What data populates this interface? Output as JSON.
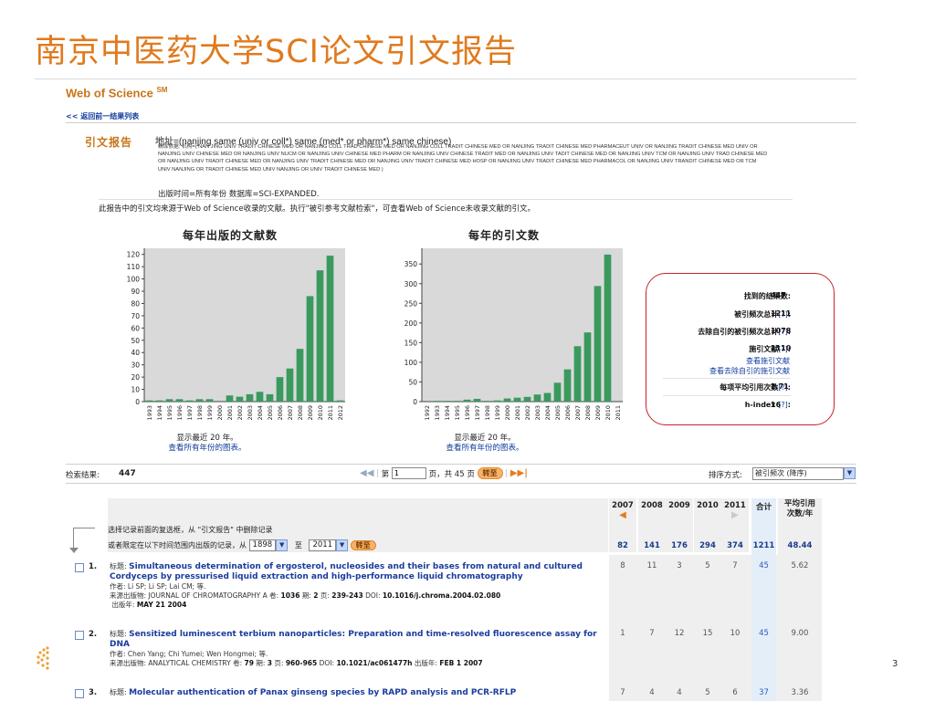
{
  "slide": {
    "title": "南京中医药大学SCI论文引文报告",
    "page_number": "3"
  },
  "wos": {
    "logo_text": "Web of Science",
    "logo_sup": "SM",
    "back_link": "<< 返回前一结果列表"
  },
  "report": {
    "label": "引文报告",
    "query": "地址=(nanjing same (univ or coll*) same (med* or pharm*) same chinese)",
    "query_detail": "精炼依据: 机构=( NAN JING UNIV TRADIT CHINESE MED OR NANJING COLL TRAD CHINESE MED OR NANJING COLL TRADIT CHINESE MED OR NANJING TRADIT CHINESE MED PHARMACEUT UNIV OR NANJING TRADIT CHINESE MED UNIV OR NANJING UNIV CHINESE MED OR NANJING UNIV NUCM OR NANJING UNIV CHINESE MED PHARM OR NANJING UNIV CHINESE TRADIT MED OR NANJING UNIV TADIT CHINESE MED OR NANJING UNIV TCM OR NANJING UNIV TRAD CHINESE MED OR NANJING UNIV TRADIT CHINESE MED OR NANJING UNIV TRADIT CHINESE MED OR NANJING UNIV TRADIT CHINESE MED HOSP OR NANJING UNIV TRADIT CHINESE MED PHARMACOL OR NANJING UNIV TRANDIT CHINESE MED OR TCM UNIV NANJING OR TRADIT CHINESE MED UNIV NANJING OR UNIV TRADIT CHINESE MED )",
    "pubtime": "出版时间=所有年份  数据库=SCI-EXPANDED.",
    "source_note": "此报告中的引文均来源于Web of Science收录的文献。执行\"被引参考文献检索\"，可查看Web of Science未收录文献的引文。"
  },
  "charts": {
    "left_title": "每年出版的文献数",
    "right_title": "每年的引文数",
    "left_note": "显示最近 20 年。",
    "right_note": "显示最近 20 年。",
    "left_link": "查看所有年份的图表。",
    "right_link": "查看所有年份的图表。"
  },
  "chart_data": [
    {
      "type": "bar",
      "title": "每年出版的文献数",
      "categories": [
        "1993",
        "1994",
        "1995",
        "1996",
        "1997",
        "1998",
        "1999",
        "2000",
        "2001",
        "2002",
        "2003",
        "2004",
        "2005",
        "2006",
        "2007",
        "2008",
        "2009",
        "2010",
        "2011",
        "2012"
      ],
      "values": [
        1,
        1,
        2,
        2,
        1,
        2,
        2,
        0,
        5,
        4,
        6,
        8,
        6,
        20,
        27,
        43,
        86,
        107,
        119,
        1
      ],
      "ylim": [
        0,
        125
      ],
      "yticks": [
        0,
        10,
        20,
        30,
        40,
        50,
        60,
        70,
        80,
        90,
        100,
        110,
        120
      ],
      "color": "#3a9a5e",
      "grid": false
    },
    {
      "type": "bar",
      "title": "每年的引文数",
      "categories": [
        "1992",
        "1993",
        "1994",
        "1995",
        "1996",
        "1997",
        "1998",
        "1999",
        "2000",
        "2001",
        "2002",
        "2003",
        "2004",
        "2005",
        "2006",
        "2007",
        "2008",
        "2009",
        "2010",
        "2011"
      ],
      "values": [
        0,
        2,
        2,
        2,
        5,
        7,
        2,
        3,
        8,
        10,
        12,
        18,
        22,
        48,
        82,
        141,
        176,
        294,
        374,
        0
      ],
      "ylim": [
        0,
        390
      ],
      "yticks": [
        0,
        50,
        100,
        150,
        200,
        250,
        300,
        350
      ],
      "color": "#3a9a5e",
      "grid": false
    }
  ],
  "stats": {
    "found_label": "找到的结果数:",
    "found_value": "447",
    "cited_label": "被引频次总计",
    "cited_value": "1211",
    "self_label": "去除自引的被引频次总计",
    "self_value": "1078",
    "citing_label": "施引文献",
    "citing_value": "1110",
    "view_citing": "查看施引文献",
    "view_citing_noself": "查看去除自引的施引文献",
    "avg_label": "每项平均引用次数",
    "avg_value": "2.71",
    "hindex_label": "h-index",
    "hindex_value": "16",
    "help": "[?]",
    "colon": ":"
  },
  "results_bar": {
    "label": "检索结果:",
    "count": "447",
    "page_prefix": "第",
    "page_value": "1",
    "page_suffix": "页，共 45 页",
    "go": "转至",
    "sort_label": "排序方式:",
    "sort_value": "被引频次 (降序)"
  },
  "table": {
    "select_hint": "选择记录前面的复选框，从 \"引文报告\" 中删除记录",
    "range_prefix": "或者限定在以下时间范围内出版的记录，从",
    "range_from": "1898",
    "range_to_label": "至",
    "range_to": "2011",
    "go": "转至",
    "years": [
      "2007",
      "2008",
      "2009",
      "2010",
      "2011"
    ],
    "sum_header": "合计",
    "avg_header": "平均引用次数/年",
    "year_totals": [
      "82",
      "141",
      "176",
      "294",
      "374"
    ],
    "grand_total": "1211",
    "grand_avg": "48.44"
  },
  "records": [
    {
      "num": "1.",
      "title_label": "标题:",
      "title": "Simultaneous determination of ergosterol, nucleosides and their bases from natural and cultured Cordyceps by pressurised liquid extraction and high-performance liquid chromatography",
      "authors": "作者: Li SP; Li SP; Lai CM; 等.",
      "source": "来源出版物: JOURNAL OF CHROMATOGRAPHY A  卷:",
      "volume": "1036",
      "issue_label": "期:",
      "issue": "2",
      "pages_label": "页:",
      "pages": "239-243",
      "doi_label": "DOI:",
      "doi": "10.1016/j.chroma.2004.02.080",
      "date_label": "出版年:",
      "date": "MAY 21 2004",
      "cites": [
        "8",
        "11",
        "3",
        "5",
        "7"
      ],
      "sum": "45",
      "avg": "5.62"
    },
    {
      "num": "2.",
      "title_label": "标题:",
      "title": "Sensitized luminescent terbium nanoparticles: Preparation and time-resolved fluorescence assay for DNA",
      "authors": "作者: Chen Yang; Chi Yumei; Wen Hongmei; 等.",
      "source": "来源出版物: ANALYTICAL CHEMISTRY  卷:",
      "volume": "79",
      "issue_label": "期:",
      "issue": "3",
      "pages_label": "页:",
      "pages": "960-965",
      "doi_label": "DOI:",
      "doi": "10.1021/ac061477h",
      "date_label": "出版年:",
      "date": "FEB 1 2007",
      "cites": [
        "1",
        "7",
        "12",
        "15",
        "10"
      ],
      "sum": "45",
      "avg": "9.00"
    },
    {
      "num": "3.",
      "title_label": "标题:",
      "title": "Molecular authentication of Panax ginseng species by RAPD analysis and PCR-RFLP",
      "cites": [
        "7",
        "4",
        "4",
        "5",
        "6"
      ],
      "sum": "37",
      "avg": "3.36"
    }
  ]
}
